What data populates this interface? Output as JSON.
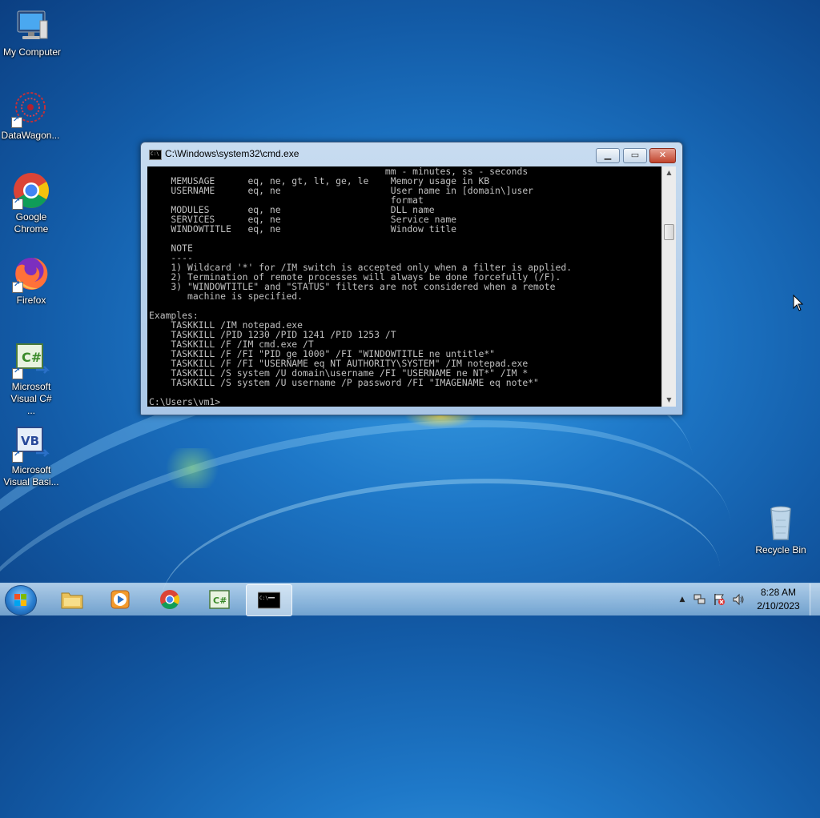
{
  "desktop": {
    "icons": [
      {
        "label": "My Computer",
        "icon": "computer-icon"
      },
      {
        "label": "DataWagon...",
        "icon": "datawagon-icon"
      },
      {
        "label": "Google Chrome",
        "icon": "chrome-icon"
      },
      {
        "label": "Firefox",
        "icon": "firefox-icon"
      },
      {
        "label": "Microsoft Visual C# ...",
        "icon": "visual-csharp-icon"
      },
      {
        "label": "Microsoft Visual Basi...",
        "icon": "visual-basic-icon"
      },
      {
        "label": "Recycle Bin",
        "icon": "recycle-bin-icon"
      }
    ]
  },
  "cmd": {
    "title": "C:\\Windows\\system32\\cmd.exe",
    "minimize_symbol": "▁",
    "maximize_symbol": "▭",
    "close_symbol": "✕",
    "lines": [
      "                                           mm - minutes, ss - seconds",
      "    MEMUSAGE      eq, ne, gt, lt, ge, le    Memory usage in KB",
      "    USERNAME      eq, ne                    User name in [domain\\]user",
      "                                            format",
      "    MODULES       eq, ne                    DLL name",
      "    SERVICES      eq, ne                    Service name",
      "    WINDOWTITLE   eq, ne                    Window title",
      "",
      "    NOTE",
      "    ----",
      "    1) Wildcard '*' for /IM switch is accepted only when a filter is applied.",
      "    2) Termination of remote processes will always be done forcefully (/F).",
      "    3) \"WINDOWTITLE\" and \"STATUS\" filters are not considered when a remote",
      "       machine is specified.",
      "",
      "Examples:",
      "    TASKKILL /IM notepad.exe",
      "    TASKKILL /PID 1230 /PID 1241 /PID 1253 /T",
      "    TASKKILL /F /IM cmd.exe /T",
      "    TASKKILL /F /FI \"PID ge 1000\" /FI \"WINDOWTITLE ne untitle*\"",
      "    TASKKILL /F /FI \"USERNAME eq NT AUTHORITY\\SYSTEM\" /IM notepad.exe",
      "    TASKKILL /S system /U domain\\username /FI \"USERNAME ne NT*\" /IM *",
      "    TASKKILL /S system /U username /P password /FI \"IMAGENAME eq note*\"",
      "",
      "C:\\Users\\vm1>"
    ]
  },
  "taskbar": {
    "items": [
      {
        "name": "explorer",
        "icon": "folder-icon",
        "active": false
      },
      {
        "name": "media-player",
        "icon": "media-player-icon",
        "active": false
      },
      {
        "name": "chrome",
        "icon": "chrome-icon",
        "active": false
      },
      {
        "name": "visual-csharp",
        "icon": "visual-csharp-icon",
        "active": false
      },
      {
        "name": "cmd",
        "icon": "cmd-icon",
        "active": true
      }
    ],
    "tray": {
      "time": "8:28 AM",
      "date": "2/10/2023",
      "show_hidden_symbol": "▲"
    }
  }
}
